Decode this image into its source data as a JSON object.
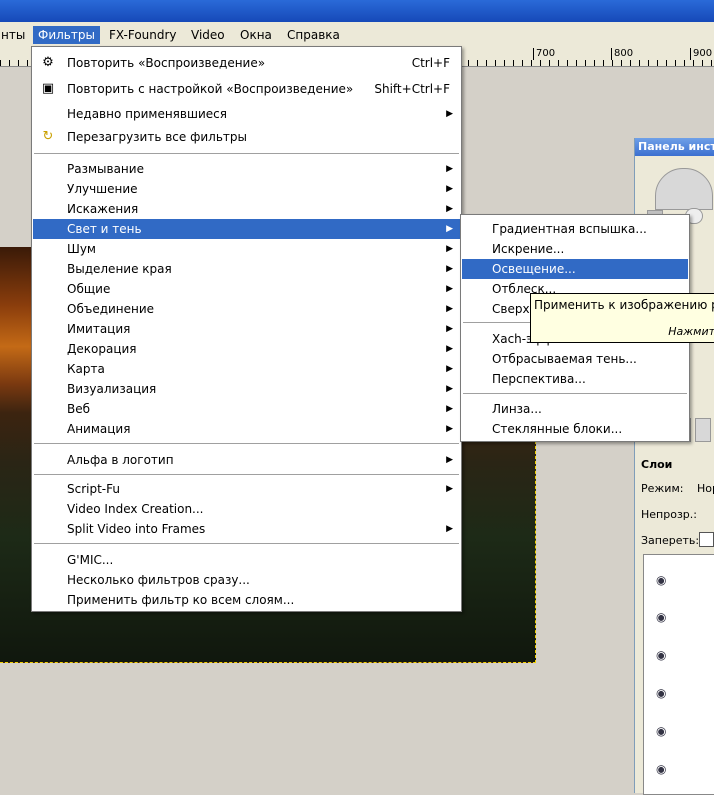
{
  "menubar": {
    "items": [
      "нты",
      "Фильтры",
      "FX-Foundry",
      "Video",
      "Окна",
      "Справка"
    ]
  },
  "ruler": {
    "labels": [
      "700",
      "800",
      "900"
    ]
  },
  "filters_menu": {
    "repeat": {
      "label": "Повторить «Воспроизведение»",
      "shortcut": "Ctrl+F"
    },
    "reshow": {
      "label": "Повторить с настройкой «Воспроизведение»",
      "shortcut": "Shift+Ctrl+F"
    },
    "recent": {
      "label": "Недавно применявшиеся"
    },
    "reset": {
      "label": "Перезагрузить все фильтры"
    },
    "categories": [
      "Размывание",
      "Улучшение",
      "Искажения",
      "Свет и тень",
      "Шум",
      "Выделение края",
      "Общие",
      "Объединение",
      "Имитация",
      "Декорация",
      "Карта",
      "Визуализация",
      "Веб",
      "Анимация"
    ],
    "alpha": "Альфа в логотип",
    "scripts": [
      "Script-Fu",
      "Video Index Creation...",
      "Split Video into Frames"
    ],
    "misc": [
      "G'MIC...",
      "Несколько фильтров сразу...",
      "Применить фильтр ко всем слоям..."
    ]
  },
  "light_menu": {
    "items": [
      "Градиентная вспышка...",
      "Искрение...",
      "Освещение...",
      "Отблеск...",
      "Сверхн"
    ],
    "items2": [
      "Xach-эффект...",
      "Отбрасываемая тень...",
      "Перспектива..."
    ],
    "items3": [
      "Линза...",
      "Стеклянные блоки..."
    ]
  },
  "tooltip": {
    "text": "Применить к изображению ра",
    "hint": "Нажмит"
  },
  "panel": {
    "title": "Панель инст",
    "layers_title": "Слои",
    "mode_label": "Режим:",
    "mode_value": "Нор",
    "opacity_label": "Непрозр.:",
    "lock_label": "Запереть:"
  }
}
